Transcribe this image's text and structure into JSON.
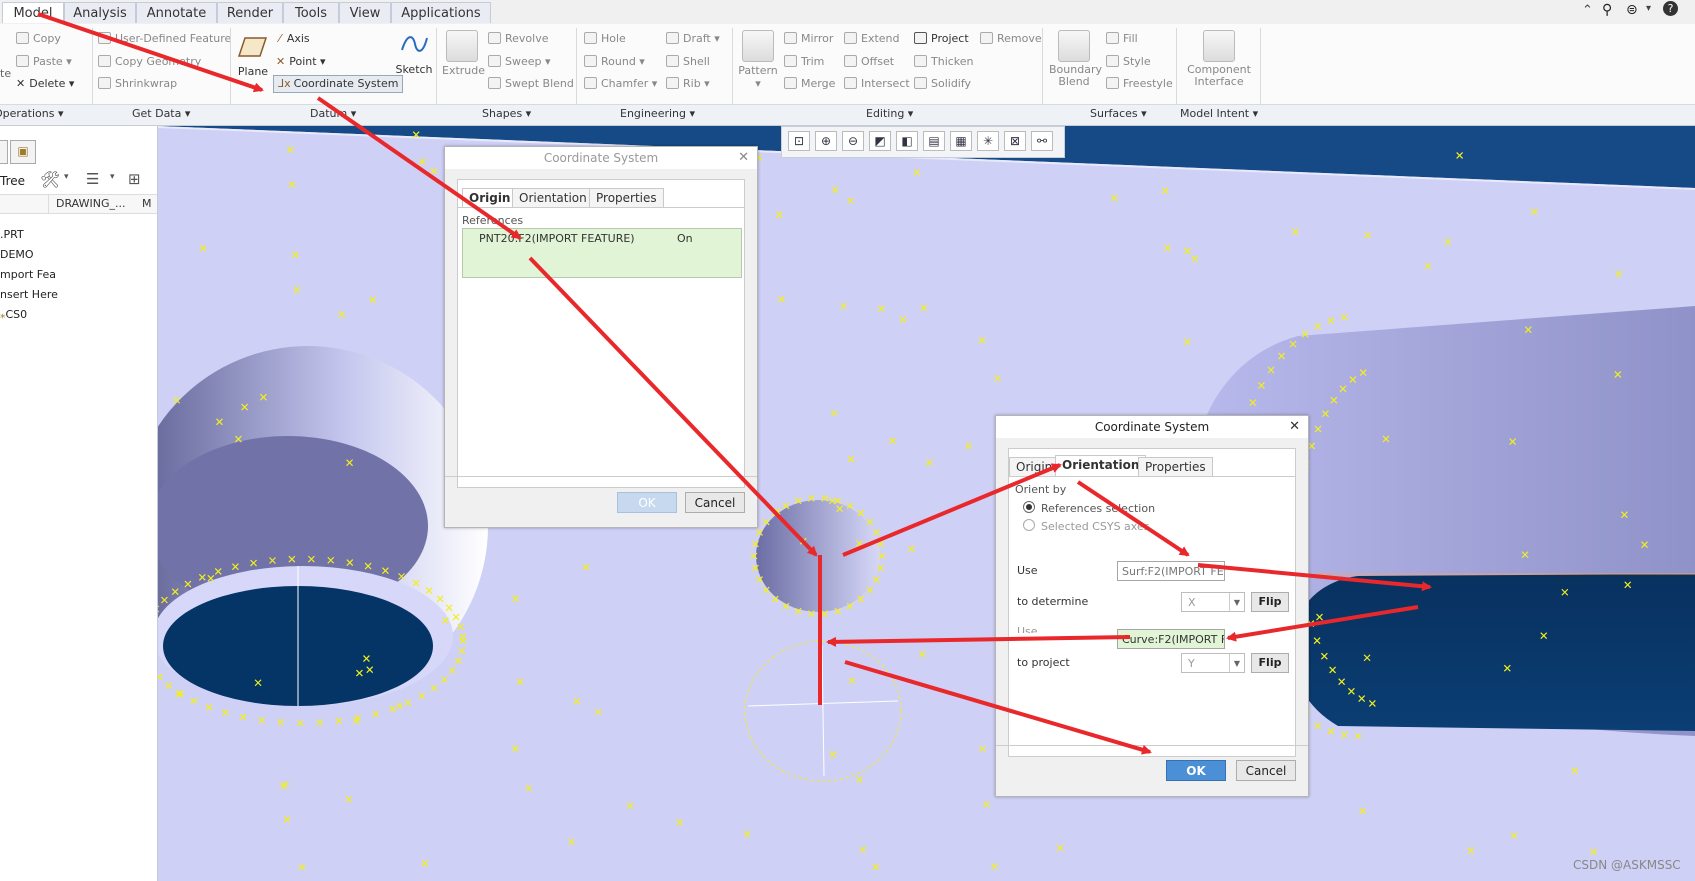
{
  "menu": {
    "tabs": [
      "Model",
      "Analysis",
      "Annotate",
      "Render",
      "Tools",
      "View",
      "Applications"
    ],
    "active": "Model",
    "right_icons": [
      "collapse-icon",
      "search-icon",
      "help-menu-icon",
      "help-icon"
    ]
  },
  "ribbon": {
    "operations": {
      "copy": "Copy",
      "paste": "Paste",
      "delete": "Delete",
      "label": "Operations"
    },
    "get_data": {
      "udf": "User-Defined Feature",
      "copy_geometry": "Copy Geometry",
      "shrinkwrap": "Shrinkwrap",
      "label": "Get Data"
    },
    "datum": {
      "plane": "Plane",
      "axis": "Axis",
      "point": "Point",
      "csys": "Coordinate System",
      "sketch": "Sketch",
      "label": "Datum"
    },
    "shapes": {
      "extrude": "Extrude",
      "revolve": "Revolve",
      "sweep": "Sweep",
      "swept_blend": "Swept Blend",
      "label": "Shapes"
    },
    "engineering": {
      "hole": "Hole",
      "round": "Round",
      "chamfer": "Chamfer",
      "draft": "Draft",
      "shell": "Shell",
      "rib": "Rib",
      "label": "Engineering"
    },
    "editing": {
      "pattern": "Pattern",
      "mirror": "Mirror",
      "trim": "Trim",
      "merge": "Merge",
      "extend": "Extend",
      "offset": "Offset",
      "intersect": "Intersect",
      "project": "Project",
      "thicken": "Thicken",
      "solidify": "Solidify",
      "remove": "Remove",
      "label": "Editing"
    },
    "surfaces": {
      "boundary_blend": "Boundary Blend",
      "fill": "Fill",
      "style": "Style",
      "freestyle": "Freestyle",
      "label": "Surfaces"
    },
    "model_intent": {
      "component_interface": "Component Interface",
      "label": "Model Intent"
    }
  },
  "left_panel": {
    "tree_label": "Tree",
    "col1": "DRAWING_...",
    "col2": "M",
    "rows": [
      ".PRT",
      "DEMO",
      "mport Fea",
      "nsert Here",
      "CS0"
    ]
  },
  "dialog1": {
    "title": "Coordinate System",
    "tabs": [
      "Origin",
      "Orientation",
      "Properties"
    ],
    "references_label": "References",
    "ref_item": "PNT20:F2(IMPORT FEATURE)",
    "ref_state": "On",
    "ok": "OK",
    "cancel": "Cancel"
  },
  "dialog2": {
    "title": "Coordinate System",
    "tabs": [
      "Origin",
      "Orientation",
      "Properties"
    ],
    "orient_by": "Orient by",
    "opt1": "References selection",
    "opt2": "Selected CSYS axes",
    "use1_label": "Use",
    "use1_value": "Surf:F2(IMPORT FE",
    "determine_label": "to determine",
    "determine_value": "X",
    "flip": "Flip",
    "use2_label": "Use",
    "use2_value": "Curve:F2(IMPORT F",
    "project_label": "to project",
    "project_value": "Y",
    "ok": "OK",
    "cancel": "Cancel"
  },
  "watermark": "CSDN @ASKMSSC",
  "colors": {
    "viewport": "#cfd0f6",
    "hole_dark": "#033566",
    "arrow": "#e8282b",
    "marker": "#f2ef1c",
    "accent": "#4b8fd6"
  }
}
